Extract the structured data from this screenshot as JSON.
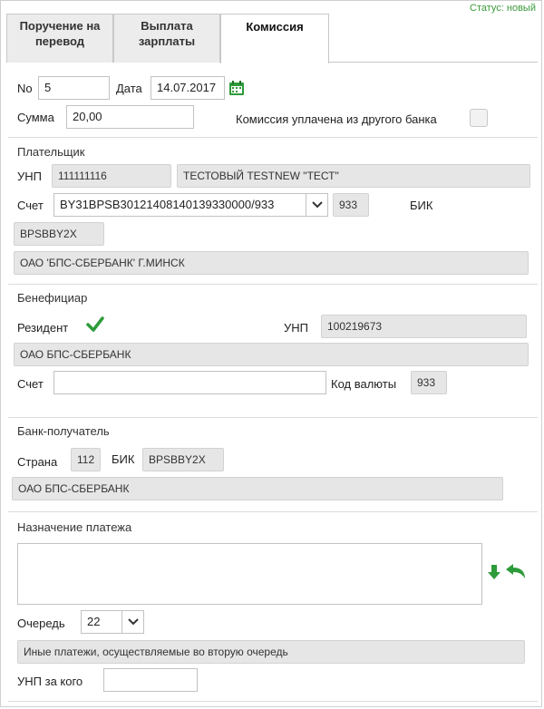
{
  "status": "Статус: новый",
  "tabs": [
    {
      "line1": "Поручение на",
      "line2": "перевод"
    },
    {
      "line1": "Выплата",
      "line2": "зарплаты"
    },
    {
      "line1": "Комиссия",
      "line2": ""
    }
  ],
  "doc": {
    "no_label": "No",
    "no_value": "5",
    "date_label": "Дата",
    "date_value": "14.07.2017",
    "sum_label": "Сумма",
    "sum_value": "20,00",
    "commission_other_bank_label": "Комиссия уплачена из другого банка"
  },
  "payer": {
    "title": "Плательщик",
    "unp_label": "УНП",
    "unp_value": "111111116",
    "name_value": "ТЕСТОВЫЙ TESTNEW \"ТЕСТ\"",
    "account_label": "Счет",
    "account_value": "BY31BPSB30121408140139330000/933",
    "currency_code": "933",
    "bik_label": "БИК",
    "bik_value": "BPSBBY2X",
    "bank_name": "ОАО 'БПС-СБЕРБАНК' Г.МИНСК"
  },
  "beneficiary": {
    "title": "Бенефициар",
    "resident_label": "Резидент",
    "unp_label": "УНП",
    "unp_value": "100219673",
    "name_value": "ОАО БПС-СБЕРБАНК",
    "account_label": "Счет",
    "account_value": "",
    "currency_label": "Код валюты",
    "currency_value": "933"
  },
  "recipient_bank": {
    "title": "Банк-получатель",
    "country_label": "Страна",
    "country_value": "112",
    "bik_label": "БИК",
    "bik_value": "BPSBBY2X",
    "bank_name": "ОАО БПС-СБЕРБАНК"
  },
  "purpose": {
    "title": "Назначение платежа",
    "text": "",
    "queue_label": "Очередь",
    "queue_value": "22",
    "queue_description": "Иные платежи, осуществляемые во вторую очередь",
    "unp_for_label": "УНП за кого",
    "unp_for_value": ""
  },
  "colors": {
    "accent_green": "#2e9b3a",
    "readonly_bg": "#e6e6e6"
  }
}
